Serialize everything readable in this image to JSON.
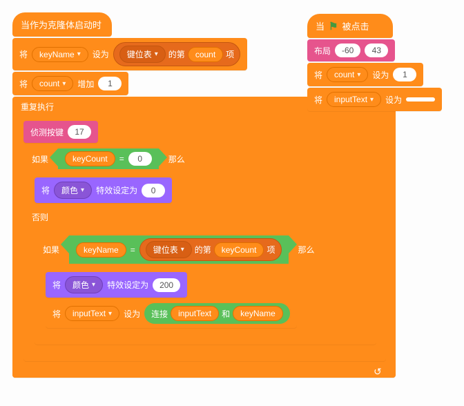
{
  "left": {
    "hat": "当作为克隆体启动时",
    "set1": {
      "pre": "将",
      "var": "keyName",
      "mid": "设为",
      "list": "键位表",
      "mid2": "的第",
      "idx": "count",
      "suf": "项"
    },
    "inc": {
      "pre": "将",
      "var": "count",
      "mid": "增加",
      "val": "1"
    },
    "forever": "重复执行",
    "detect": {
      "label": "侦测按键",
      "val": "17"
    },
    "if1": {
      "pre": "如果",
      "var": "keyCount",
      "op": "=",
      "val": "0",
      "suf": "那么"
    },
    "effect0": {
      "pre": "将",
      "var": "颜色",
      "mid": "特效设定为",
      "val": "0"
    },
    "else": "否则",
    "if2": {
      "pre": "如果",
      "var": "keyName",
      "op": "=",
      "list": "键位表",
      "mid2": "的第",
      "idx": "keyCount",
      "suf": "项",
      "then": "那么"
    },
    "effect200": {
      "pre": "将",
      "var": "颜色",
      "mid": "特效设定为",
      "val": "200"
    },
    "join": {
      "pre": "将",
      "var": "inputText",
      "mid": "设为",
      "joinlbl": "连接",
      "a": "inputText",
      "and": "和",
      "b": "keyName"
    }
  },
  "right": {
    "hat": {
      "pre": "当",
      "suf": "被点击"
    },
    "layout": {
      "label": "布局",
      "x": "-60",
      "y": "43"
    },
    "setcount": {
      "pre": "将",
      "var": "count",
      "mid": "设为",
      "val": "1"
    },
    "setinput": {
      "pre": "将",
      "var": "inputText",
      "mid": "设为",
      "val": ""
    }
  }
}
